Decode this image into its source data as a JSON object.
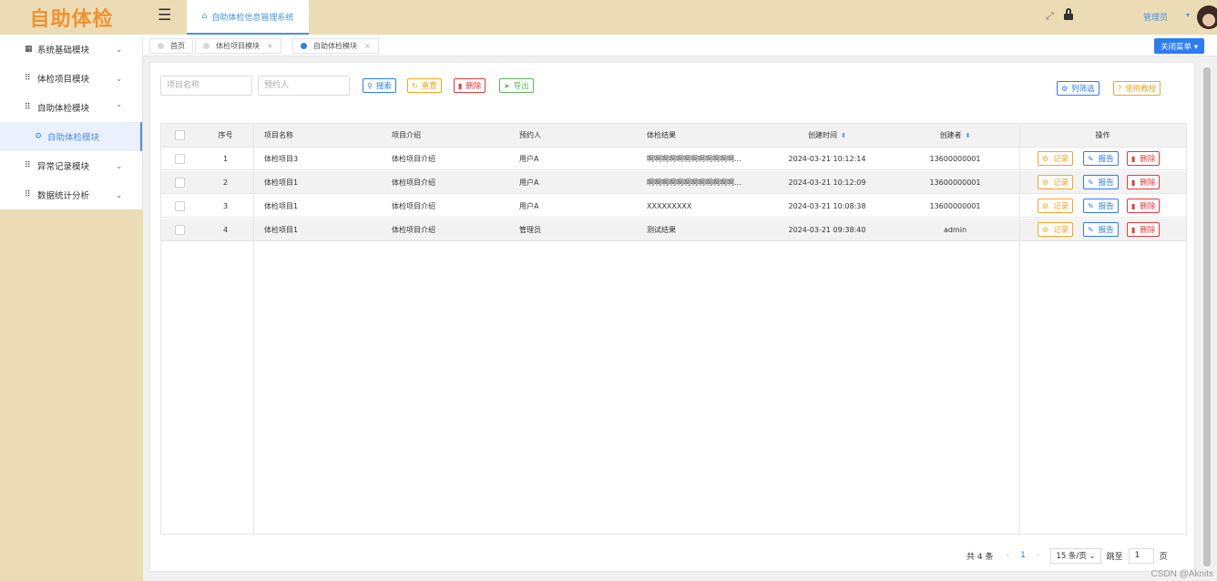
{
  "logo": "自助体检",
  "sidebar": {
    "items": [
      {
        "icon": "▦",
        "icon_name": "grid-icon",
        "label": "系统基础模块",
        "chevron": "⌄"
      },
      {
        "icon": "⠿",
        "icon_name": "apps-icon",
        "label": "体检项目模块",
        "chevron": "⌄"
      },
      {
        "icon": "⠿",
        "icon_name": "apps-icon",
        "label": "自助体检模块",
        "chevron": "⌃"
      },
      {
        "icon": "⚙",
        "icon_name": "gear-icon",
        "label": "自助体检模块",
        "chevron": ""
      },
      {
        "icon": "⠿",
        "icon_name": "apps-icon",
        "label": "异常记录模块",
        "chevron": "⌄"
      },
      {
        "icon": "⠿",
        "icon_name": "apps-icon",
        "label": "数据统计分析",
        "chevron": "⌄"
      }
    ]
  },
  "header": {
    "home_tab": "自助体检信息管理系统",
    "user": "管理员",
    "user_chevron": "▾",
    "fullscreen_icon": "⤢"
  },
  "tags": [
    {
      "label": "首页",
      "closable": false
    },
    {
      "label": "体检项目模块",
      "closable": true
    },
    {
      "label": "自助体检模块",
      "closable": true
    }
  ],
  "tag_close": "×",
  "close_menu": "关闭菜单 ▾",
  "search": {
    "name_placeholder": "项目名称",
    "person_placeholder": "预约人",
    "search": "搜索",
    "reset": "重置",
    "delete": "删除",
    "export": "导出",
    "column_filter": "列筛选",
    "tutorial": "使用教程"
  },
  "table": {
    "columns": [
      "序号",
      "项目名称",
      "项目介绍",
      "预约人",
      "体检结果",
      "创建时间",
      "创建者",
      "操作"
    ],
    "sort_icon": "⬍",
    "rows": [
      {
        "no": "1",
        "name": "体检项目3",
        "intro": "体检项目介绍",
        "person": "用户A",
        "result": "啊啊啊啊啊啊啊啊啊啊啊啊...",
        "time": "2024-03-21 10:12:14",
        "creator": "13600000001"
      },
      {
        "no": "2",
        "name": "体检项目1",
        "intro": "体检项目介绍",
        "person": "用户A",
        "result": "啊啊啊啊啊啊啊啊啊啊啊啊...",
        "time": "2024-03-21 10:12:09",
        "creator": "13600000001"
      },
      {
        "no": "3",
        "name": "体检项目1",
        "intro": "体检项目介绍",
        "person": "用户A",
        "result": "XXXXXXXXX",
        "time": "2024-03-21 10:08:38",
        "creator": "13600000001"
      },
      {
        "no": "4",
        "name": "体检项目1",
        "intro": "体检项目介绍",
        "person": "管理员",
        "result": "测试结果",
        "time": "2024-03-21 09:38:40",
        "creator": "admin"
      }
    ],
    "actions": {
      "record": "记录",
      "report": "报告",
      "delete": "删除"
    }
  },
  "pager": {
    "total": "共 4 条",
    "prev": "‹",
    "page": "1",
    "next": "›",
    "page_size": "15 条/页 ⌄",
    "goto": "跳至",
    "goto_value": "1",
    "page_unit": "页"
  },
  "watermark": "CSDN @Aknits",
  "colors": {
    "accent": "#2d7cf4",
    "sidebar_bg": "#ecdcb5",
    "logo": "#f3912e",
    "danger": "#e03c3c",
    "warn": "#f5a623",
    "success": "#5cb85c"
  }
}
